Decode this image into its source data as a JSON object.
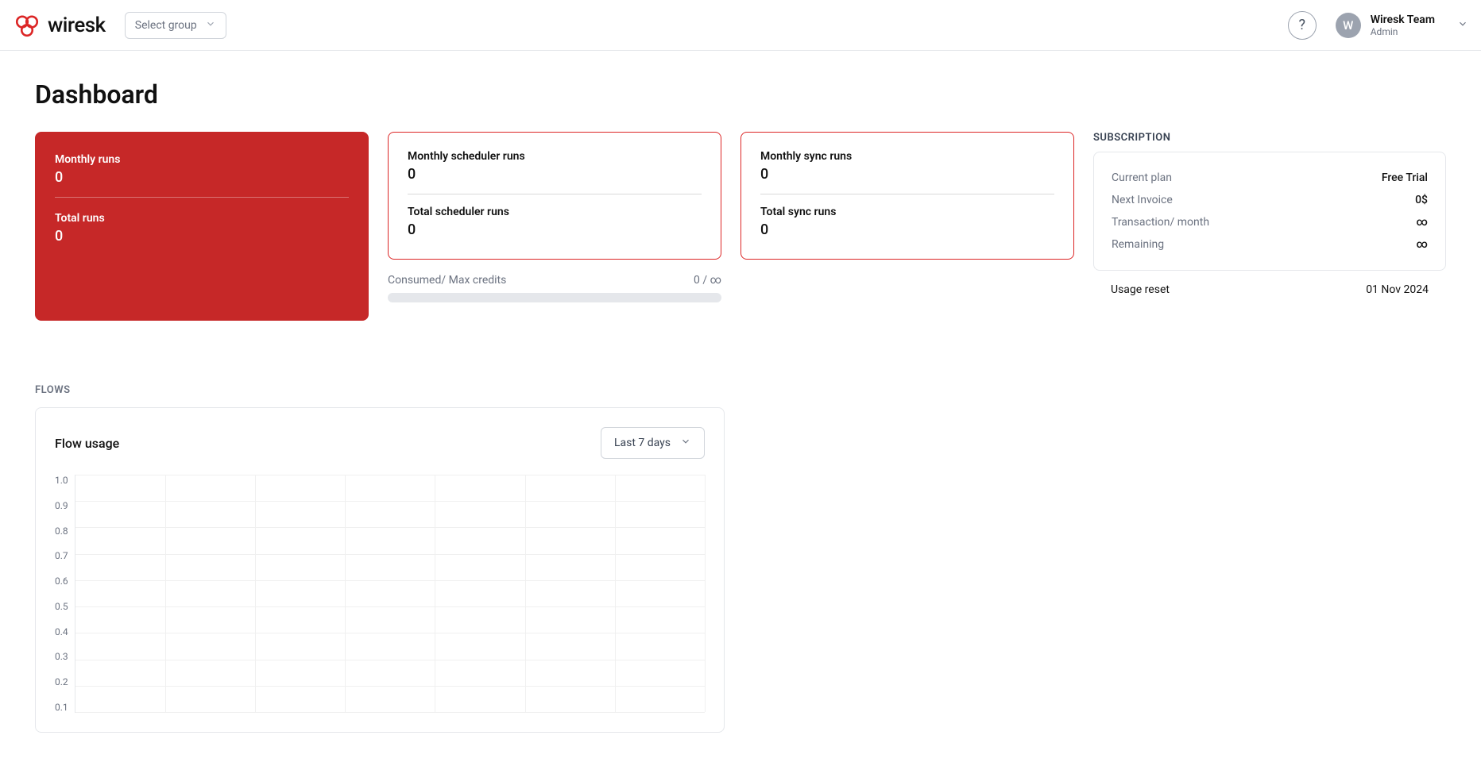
{
  "header": {
    "brand": "wiresk",
    "group_select": "Select group",
    "user_initial": "W",
    "user_name": "Wiresk Team",
    "user_role": "Admin"
  },
  "page": {
    "title": "Dashboard"
  },
  "cards": {
    "runs": {
      "monthly_label": "Monthly runs",
      "monthly_value": "0",
      "total_label": "Total runs",
      "total_value": "0"
    },
    "scheduler": {
      "monthly_label": "Monthly scheduler runs",
      "monthly_value": "0",
      "total_label": "Total scheduler runs",
      "total_value": "0"
    },
    "sync": {
      "monthly_label": "Monthly sync runs",
      "monthly_value": "0",
      "total_label": "Total sync runs",
      "total_value": "0"
    }
  },
  "credits": {
    "label": "Consumed/ Max credits",
    "value": "0 / ∞"
  },
  "subscription": {
    "heading": "SUBSCRIPTION",
    "rows": [
      {
        "k": "Current plan",
        "v": "Free Trial"
      },
      {
        "k": "Next Invoice",
        "v": "0$"
      },
      {
        "k": "Transaction/ month",
        "v": "∞"
      },
      {
        "k": "Remaining",
        "v": "∞"
      }
    ],
    "usage_reset_label": "Usage reset",
    "usage_reset_value": "01 Nov 2024"
  },
  "flows": {
    "heading": "FLOWS",
    "title": "Flow usage",
    "range": "Last 7 days"
  },
  "chart_data": {
    "type": "line",
    "title": "Flow usage",
    "xlabel": "",
    "ylabel": "",
    "ylim": [
      0,
      1.0
    ],
    "y_ticks": [
      "1.0",
      "0.9",
      "0.8",
      "0.7",
      "0.6",
      "0.5",
      "0.4",
      "0.3",
      "0.2",
      "0.1"
    ],
    "categories": [],
    "values": []
  }
}
